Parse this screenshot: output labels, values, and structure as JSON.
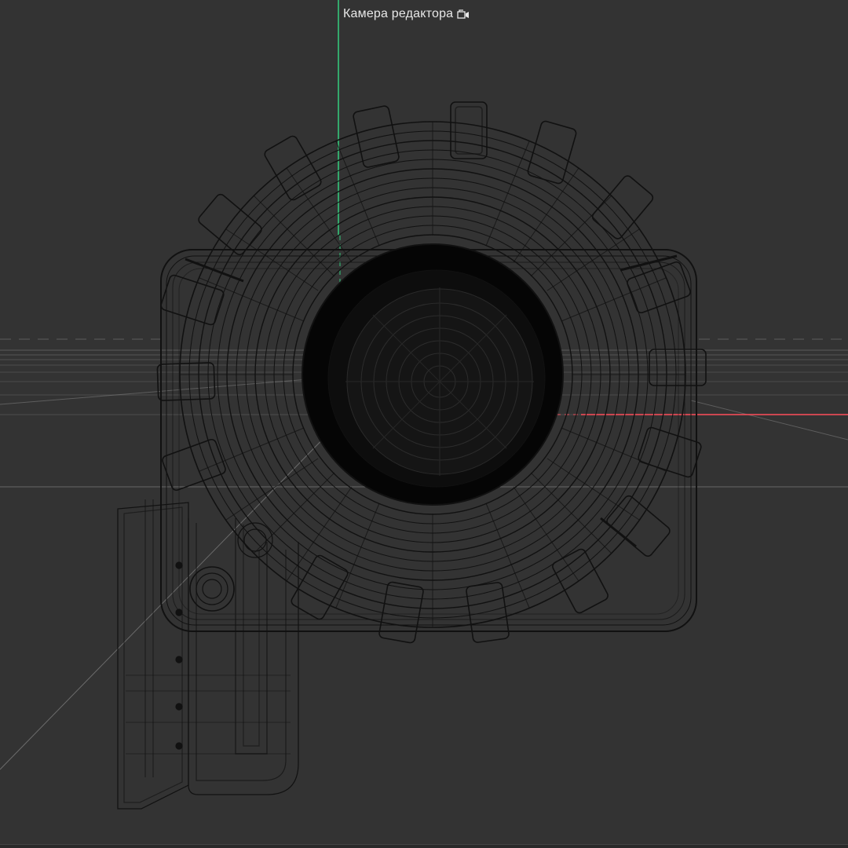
{
  "viewport": {
    "camera_label": "Камера редактора",
    "camera_icon": "camera-icon",
    "background_color": "#333333",
    "axis_colors": {
      "x": "#ff4d5a",
      "y": "#35d07f",
      "z": "#4d7dff"
    },
    "wire_color": "#111111",
    "grid_color": "#6a6a6a"
  }
}
